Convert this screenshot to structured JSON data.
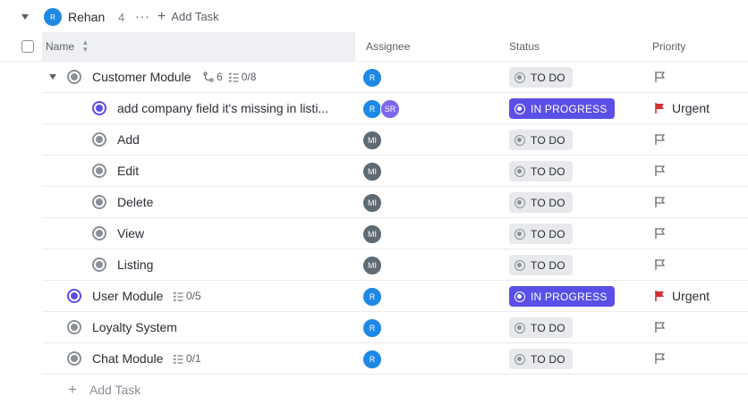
{
  "group": {
    "avatar_initial": "R",
    "name": "Rehan",
    "count": "4",
    "more": "···",
    "add_task_label": "Add Task"
  },
  "columns": {
    "name": "Name",
    "sort_icon": "sort-icon",
    "assignee": "Assignee",
    "status": "Status",
    "priority": "Priority"
  },
  "tasks": [
    {
      "name": "Customer Module",
      "status": "TO DO",
      "assignees": [
        "R"
      ],
      "priority": "",
      "subtasks": "6",
      "checklist": "0/8"
    },
    {
      "name": "add company field it's missing in listi...",
      "status": "IN PROGRESS",
      "assignees": [
        "R",
        "SR"
      ],
      "priority": "Urgent"
    },
    {
      "name": "Add",
      "status": "TO DO",
      "assignees": [
        "MI"
      ],
      "priority": ""
    },
    {
      "name": "Edit",
      "status": "TO DO",
      "assignees": [
        "MI"
      ],
      "priority": ""
    },
    {
      "name": "Delete",
      "status": "TO DO",
      "assignees": [
        "MI"
      ],
      "priority": ""
    },
    {
      "name": "View",
      "status": "TO DO",
      "assignees": [
        "MI"
      ],
      "priority": ""
    },
    {
      "name": "Listing",
      "status": "TO DO",
      "assignees": [
        "MI"
      ],
      "priority": ""
    },
    {
      "name": "User Module",
      "status": "IN PROGRESS",
      "assignees": [
        "R"
      ],
      "priority": "Urgent",
      "checklist": "0/5"
    },
    {
      "name": "Loyalty System",
      "status": "TO DO",
      "assignees": [
        "R"
      ],
      "priority": ""
    },
    {
      "name": "Chat Module",
      "status": "TO DO",
      "assignees": [
        "R"
      ],
      "priority": "",
      "checklist": "0/1"
    }
  ],
  "footer": {
    "add_task_label": "Add Task"
  },
  "colors": {
    "todo_badge_bg": "#e8e9ec",
    "progress_badge_bg": "#5a4fe6",
    "urgent_flag": "#d32f2f",
    "assignee_r": "#1e88e5",
    "assignee_mi": "#5f6b73",
    "assignee_sr": "#7b68ee"
  }
}
